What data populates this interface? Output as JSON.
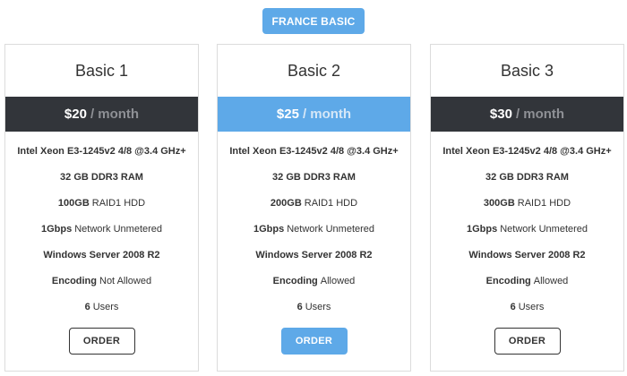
{
  "tab": {
    "label": "FRANCE BASIC"
  },
  "plans": [
    {
      "title": "Basic 1",
      "price": "$20",
      "period": "/ month",
      "features": [
        {
          "bold": "Intel Xeon E3-1245v2 4/8 @3.4 GHz+",
          "rest": ""
        },
        {
          "bold": "32 GB DDR3 RAM",
          "rest": ""
        },
        {
          "bold": "100GB",
          "rest": "RAID1 HDD"
        },
        {
          "bold": "1Gbps",
          "rest": "Network Unmetered"
        },
        {
          "bold": "Windows Server 2008 R2",
          "rest": ""
        },
        {
          "bold": "Encoding",
          "rest": "Not Allowed"
        },
        {
          "bold": "6",
          "rest": "Users"
        }
      ],
      "button": "ORDER"
    },
    {
      "title": "Basic 2",
      "price": "$25",
      "period": "/ month",
      "features": [
        {
          "bold": "Intel Xeon E3-1245v2 4/8 @3.4 GHz+",
          "rest": ""
        },
        {
          "bold": "32 GB DDR3 RAM",
          "rest": ""
        },
        {
          "bold": "200GB",
          "rest": "RAID1 HDD"
        },
        {
          "bold": "1Gbps",
          "rest": "Network Unmetered"
        },
        {
          "bold": "Windows Server 2008 R2",
          "rest": ""
        },
        {
          "bold": "Encoding",
          "rest": "Allowed"
        },
        {
          "bold": "6",
          "rest": "Users"
        }
      ],
      "button": "ORDER"
    },
    {
      "title": "Basic 3",
      "price": "$30",
      "period": "/ month",
      "features": [
        {
          "bold": "Intel Xeon E3-1245v2 4/8 @3.4 GHz+",
          "rest": ""
        },
        {
          "bold": "32 GB DDR3 RAM",
          "rest": ""
        },
        {
          "bold": "300GB",
          "rest": "RAID1 HDD"
        },
        {
          "bold": "1Gbps",
          "rest": "Network Unmetered"
        },
        {
          "bold": "Windows Server 2008 R2",
          "rest": ""
        },
        {
          "bold": "Encoding",
          "rest": "Allowed"
        },
        {
          "bold": "6",
          "rest": "Users"
        }
      ],
      "button": "ORDER"
    }
  ],
  "colors": {
    "accent": "#5ea9e8",
    "dark": "#32353a",
    "border": "#dcdcdc"
  }
}
